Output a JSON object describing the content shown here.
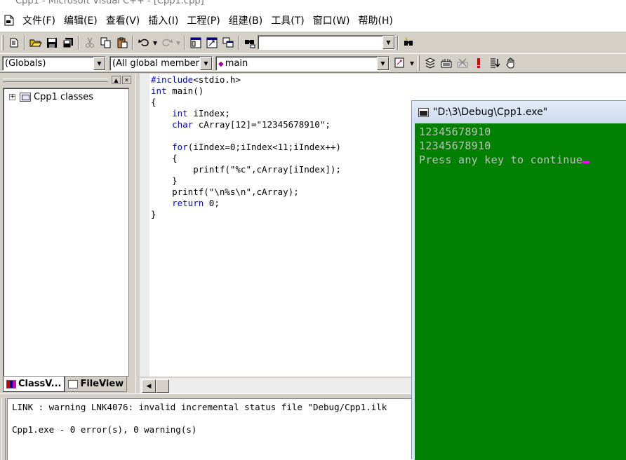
{
  "window": {
    "title": "Cpp1 - Microsoft Visual C++ - [Cpp1.cpp]"
  },
  "menu": {
    "items": [
      "文件(F)",
      "编辑(E)",
      "查看(V)",
      "插入(I)",
      "工程(P)",
      "组建(B)",
      "工具(T)",
      "窗口(W)",
      "帮助(H)"
    ]
  },
  "toolbar": {
    "find_combo_value": ""
  },
  "wizardbar": {
    "scope_combo": "(Globals)",
    "filter_combo": "(All global member",
    "member_combo": "main"
  },
  "workspace": {
    "tree_root": "Cpp1 classes",
    "tabs": [
      "ClassV...",
      "FileView"
    ]
  },
  "editor": {
    "lines": [
      "#include<stdio.h>",
      "int main()",
      "{",
      "    int iIndex;",
      "    char cArray[12]=\"12345678910\";",
      "",
      "    for(iIndex=0;iIndex<11;iIndex++)",
      "    {",
      "        printf(\"%c\",cArray[iIndex]);",
      "    }",
      "    printf(\"\\n%s\\n\",cArray);",
      "    return 0;",
      "}"
    ]
  },
  "output": {
    "lines": [
      "LINK : warning LNK4076: invalid incremental status file \"Debug/Cpp1.ilk",
      "",
      "Cpp1.exe - 0 error(s), 0 warning(s)"
    ]
  },
  "console": {
    "title": "\"D:\\3\\Debug\\Cpp1.exe\"",
    "lines": [
      "12345678910",
      "12345678910",
      "Press any key to continue"
    ],
    "colors": {
      "background": "#008000",
      "text": "#c0c0c0",
      "cursor": "#ff00ff"
    }
  }
}
